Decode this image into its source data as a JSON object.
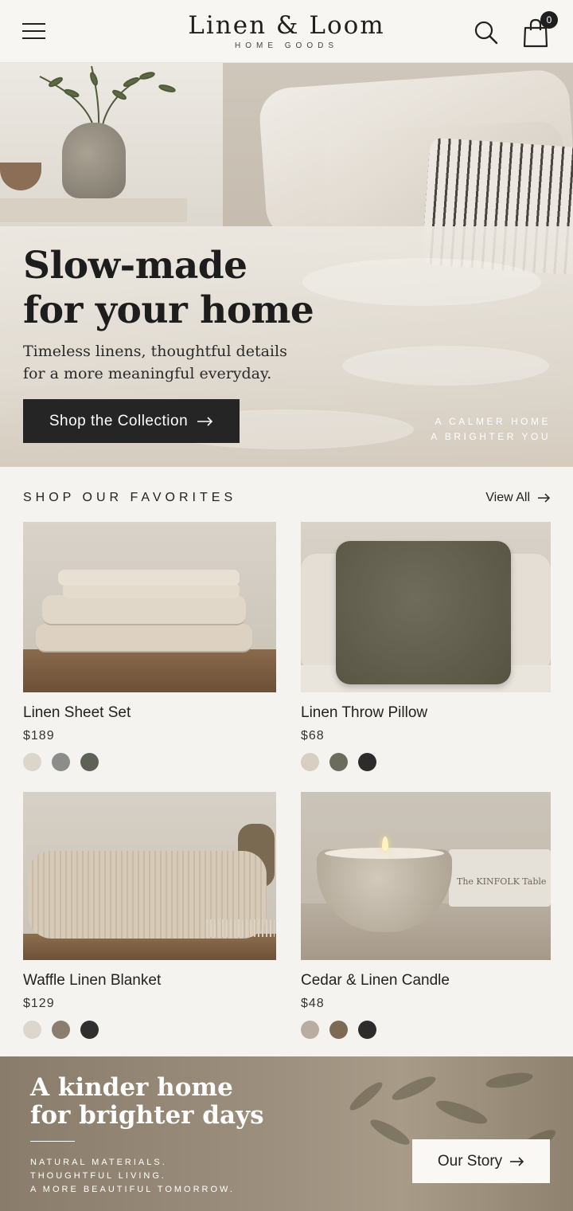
{
  "header": {
    "brand": "Linen & Loom",
    "brand_sub": "HOME GOODS",
    "cart_count": "0"
  },
  "hero": {
    "title_line1": "Slow-made",
    "title_line2": "for your home",
    "subtitle_line1": "Timeless linens, thoughtful details",
    "subtitle_line2": "for a more meaningful everyday.",
    "cta_label": "Shop the Collection",
    "tagline_line1": "A CALMER HOME",
    "tagline_line2": "A BRIGHTER YOU"
  },
  "favorites": {
    "heading": "SHOP OUR FAVORITES",
    "view_all": "View All",
    "products": [
      {
        "name": "Linen Sheet Set",
        "price": "$189",
        "swatches": [
          "#dcd5ca",
          "#8a8d8a",
          "#5e6256"
        ]
      },
      {
        "name": "Linen Throw Pillow",
        "price": "$68",
        "swatches": [
          "#d8cec2",
          "#6b6c5c",
          "#2c2c2c"
        ]
      },
      {
        "name": "Waffle Linen Blanket",
        "price": "$129",
        "swatches": [
          "#ddd6cc",
          "#8c7e6f",
          "#2f2f2f"
        ]
      },
      {
        "name": "Cedar & Linen Candle",
        "price": "$48",
        "swatches": [
          "#b8ada0",
          "#7d6a55",
          "#2c2c2c"
        ]
      }
    ]
  },
  "promo": {
    "title_line1": "A kinder home",
    "title_line2": "for brighter days",
    "line1": "NATURAL MATERIALS.",
    "line2": "THOUGHTFUL LIVING.",
    "line3": "A MORE BEAUTIFUL TOMORROW.",
    "cta_label": "Our Story"
  },
  "decor": {
    "candle_book_text": "The KINFOLK Table"
  },
  "icons": {
    "menu": "hamburger-menu-icon",
    "search": "search-icon",
    "cart": "shopping-bag-icon",
    "arrow": "arrow-right-icon"
  },
  "colors": {
    "background": "#f5f3ef",
    "dark_button": "#252525",
    "text": "#222222"
  }
}
